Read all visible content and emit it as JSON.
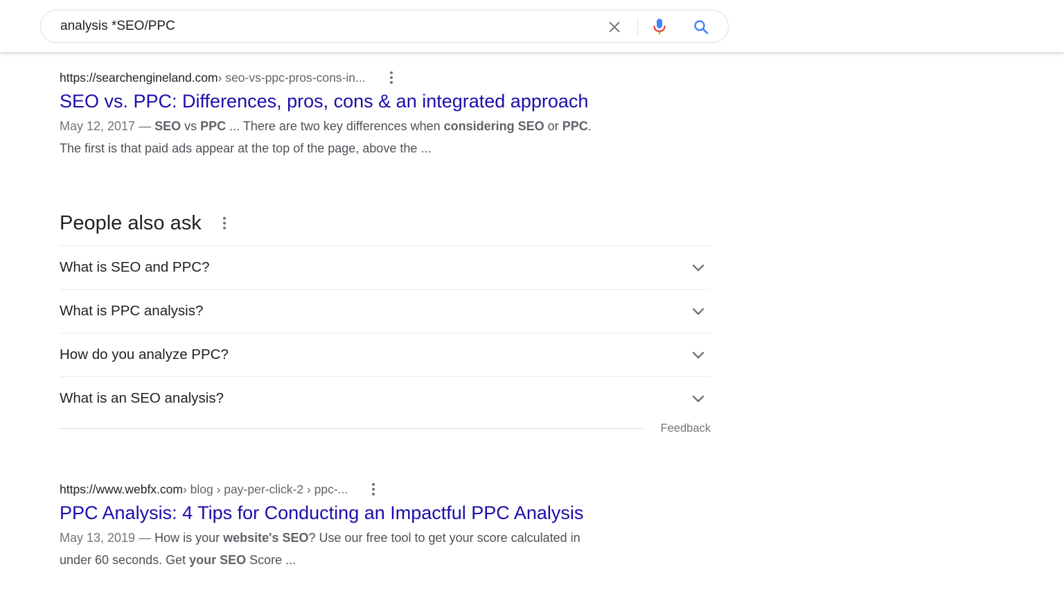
{
  "search": {
    "query": "analysis *SEO/PPC"
  },
  "colors": {
    "link_blue": "#1a0dab",
    "mic_blue": "#4285f4",
    "mic_red": "#ea4335",
    "search_icon_blue": "#4285f4"
  },
  "results": [
    {
      "domain": "https://searchengineland.com",
      "path": " › seo-vs-ppc-pros-cons-in...",
      "title": "SEO vs. PPC: Differences, pros, cons & an integrated approach",
      "date": "May 12, 2017",
      "separator": " — ",
      "snippet_line1": [
        {
          "text": "SEO",
          "bold": true
        },
        {
          "text": " vs ",
          "bold": false
        },
        {
          "text": "PPC",
          "bold": true
        },
        {
          "text": " ... There are two key differences when ",
          "bold": false
        },
        {
          "text": "considering SEO",
          "bold": true
        },
        {
          "text": " or ",
          "bold": false
        },
        {
          "text": "PPC",
          "bold": true
        },
        {
          "text": ".",
          "bold": false
        }
      ],
      "snippet_line2": "The first is that paid ads appear at the top of the page, above the ..."
    },
    {
      "domain": "https://www.webfx.com",
      "path": " › blog › pay-per-click-2 › ppc-...",
      "title": "PPC Analysis: 4 Tips for Conducting an Impactful PPC Analysis",
      "date": "May 13, 2019",
      "separator": " — ",
      "snippet_line1": [
        {
          "text": "How is your ",
          "bold": false
        },
        {
          "text": "website's SEO",
          "bold": true
        },
        {
          "text": "? Use our free tool to get your score calculated in",
          "bold": false
        }
      ],
      "snippet_line2_parts": [
        {
          "text": "under 60 seconds. Get ",
          "bold": false
        },
        {
          "text": "your SEO",
          "bold": true
        },
        {
          "text": " Score ...",
          "bold": false
        }
      ]
    }
  ],
  "people_also_ask": {
    "title": "People also ask",
    "questions": [
      "What is SEO and PPC?",
      "What is PPC analysis?",
      "How do you analyze PPC?",
      "What is an SEO analysis?"
    ],
    "feedback": "Feedback"
  }
}
